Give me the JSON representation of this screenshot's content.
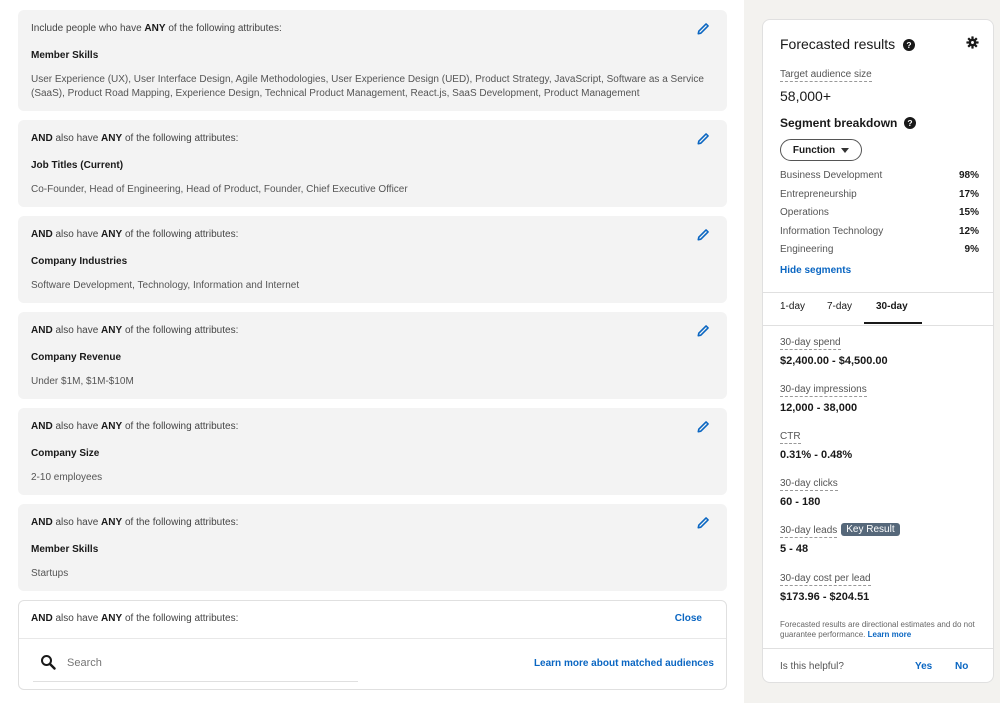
{
  "criteria": [
    {
      "head_prefix": "Include people who have ",
      "head_and": "",
      "head_mid": "",
      "head_any": "ANY",
      "head_suffix": " of the following attributes:",
      "title": "Member Skills",
      "values": "User Experience (UX), User Interface Design, Agile Methodologies, User Experience Design (UED), Product Strategy, JavaScript, Software as a Service (SaaS), Product Road Mapping, Experience Design, Technical Product Management, React.js, SaaS Development, Product Management"
    },
    {
      "head_prefix": "",
      "head_and": "AND",
      "head_mid": " also have ",
      "head_any": "ANY",
      "head_suffix": " of the following attributes:",
      "title": "Job Titles (Current)",
      "values": "Co-Founder, Head of Engineering, Head of Product, Founder, Chief Executive Officer"
    },
    {
      "head_prefix": "",
      "head_and": "AND",
      "head_mid": " also have ",
      "head_any": "ANY",
      "head_suffix": " of the following attributes:",
      "title": "Company Industries",
      "values": "Software Development, Technology, Information and Internet"
    },
    {
      "head_prefix": "",
      "head_and": "AND",
      "head_mid": " also have ",
      "head_any": "ANY",
      "head_suffix": " of the following attributes:",
      "title": "Company Revenue",
      "values": "Under $1M, $1M-$10M"
    },
    {
      "head_prefix": "",
      "head_and": "AND",
      "head_mid": " also have ",
      "head_any": "ANY",
      "head_suffix": " of the following attributes:",
      "title": "Company Size",
      "values": "2-10 employees"
    },
    {
      "head_prefix": "",
      "head_and": "AND",
      "head_mid": " also have ",
      "head_any": "ANY",
      "head_suffix": " of the following attributes:",
      "title": "Member Skills",
      "values": "Startups"
    }
  ],
  "open_criterion": {
    "head_and": "AND",
    "head_mid": " also have ",
    "head_any": "ANY",
    "head_suffix": " of the following attributes:",
    "close_label": "Close",
    "search_placeholder": "Search",
    "learn_more": "Learn more about matched audiences"
  },
  "forecast": {
    "title": "Forecasted results",
    "target_label": "Target audience size",
    "target_value": "58,000+",
    "segment_title": "Segment breakdown",
    "segment_dropdown": "Function",
    "segments": [
      {
        "name": "Business Development",
        "pct": "98%"
      },
      {
        "name": "Entrepreneurship",
        "pct": "17%"
      },
      {
        "name": "Operations",
        "pct": "15%"
      },
      {
        "name": "Information Technology",
        "pct": "12%"
      },
      {
        "name": "Engineering",
        "pct": "9%"
      }
    ],
    "hide_segments": "Hide segments",
    "tabs": [
      "1-day",
      "7-day",
      "30-day"
    ],
    "active_tab": "30-day",
    "metrics": {
      "spend_label": "30-day spend",
      "spend_value": "$2,400.00 - $4,500.00",
      "impressions_label": "30-day impressions",
      "impressions_value": "12,000 - 38,000",
      "ctr_label": "CTR",
      "ctr_value": "0.31% - 0.48%",
      "clicks_label": "30-day clicks",
      "clicks_value": "60 - 180",
      "leads_label": "30-day leads",
      "leads_badge": "Key Result",
      "leads_value": "5 - 48",
      "cpl_label": "30-day cost per lead",
      "cpl_value": "$173.96 - $204.51"
    },
    "disclaimer": "Forecasted results are directional estimates and do not guarantee performance.",
    "disclaimer_link": "Learn more",
    "helpful_q": "Is this helpful?",
    "yes": "Yes",
    "no": "No"
  },
  "colors": {
    "accent": "#0a66c2",
    "badge": "#56687a",
    "card_bg": "#f3f3f3",
    "sidebar_bg": "#f3f2ef"
  }
}
